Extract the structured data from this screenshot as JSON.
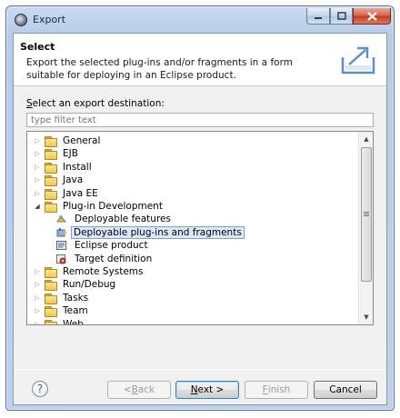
{
  "window": {
    "title": "Export"
  },
  "header": {
    "title": "Select",
    "description": "Export the selected plug-ins and/or fragments in a form suitable for deploying in an Eclipse product."
  },
  "destination": {
    "label_mnemonic": "S",
    "label_rest": "elect an export destination:",
    "filter_placeholder": "type filter text"
  },
  "tree": {
    "items": [
      {
        "label": "General",
        "icon": "folder-icon",
        "level": 0,
        "expanded": false
      },
      {
        "label": "EJB",
        "icon": "folder-icon",
        "level": 0,
        "expanded": false
      },
      {
        "label": "Install",
        "icon": "folder-icon",
        "level": 0,
        "expanded": false
      },
      {
        "label": "Java",
        "icon": "folder-icon",
        "level": 0,
        "expanded": false
      },
      {
        "label": "Java EE",
        "icon": "folder-icon",
        "level": 0,
        "expanded": false
      },
      {
        "label": "Plug-in Development",
        "icon": "folder-icon",
        "level": 0,
        "expanded": true
      },
      {
        "label": "Deployable features",
        "icon": "feature-icon",
        "level": 1
      },
      {
        "label": "Deployable plug-ins and fragments",
        "icon": "plugin-icon",
        "level": 1,
        "selected": true
      },
      {
        "label": "Eclipse product",
        "icon": "product-icon",
        "level": 1
      },
      {
        "label": "Target definition",
        "icon": "target-icon",
        "level": 1
      },
      {
        "label": "Remote Systems",
        "icon": "folder-icon",
        "level": 0,
        "expanded": false
      },
      {
        "label": "Run/Debug",
        "icon": "folder-icon",
        "level": 0,
        "expanded": false
      },
      {
        "label": "Tasks",
        "icon": "folder-icon",
        "level": 0,
        "expanded": false
      },
      {
        "label": "Team",
        "icon": "folder-icon",
        "level": 0,
        "expanded": false
      },
      {
        "label": "Web",
        "icon": "folder-icon",
        "level": 0,
        "expanded": false
      }
    ]
  },
  "buttons": {
    "help": "?",
    "back_prefix": "< ",
    "back_mnemonic": "B",
    "back_rest": "ack",
    "next_mnemonic": "N",
    "next_rest": "ext >",
    "finish_mnemonic": "F",
    "finish_rest": "inish",
    "cancel": "Cancel"
  }
}
